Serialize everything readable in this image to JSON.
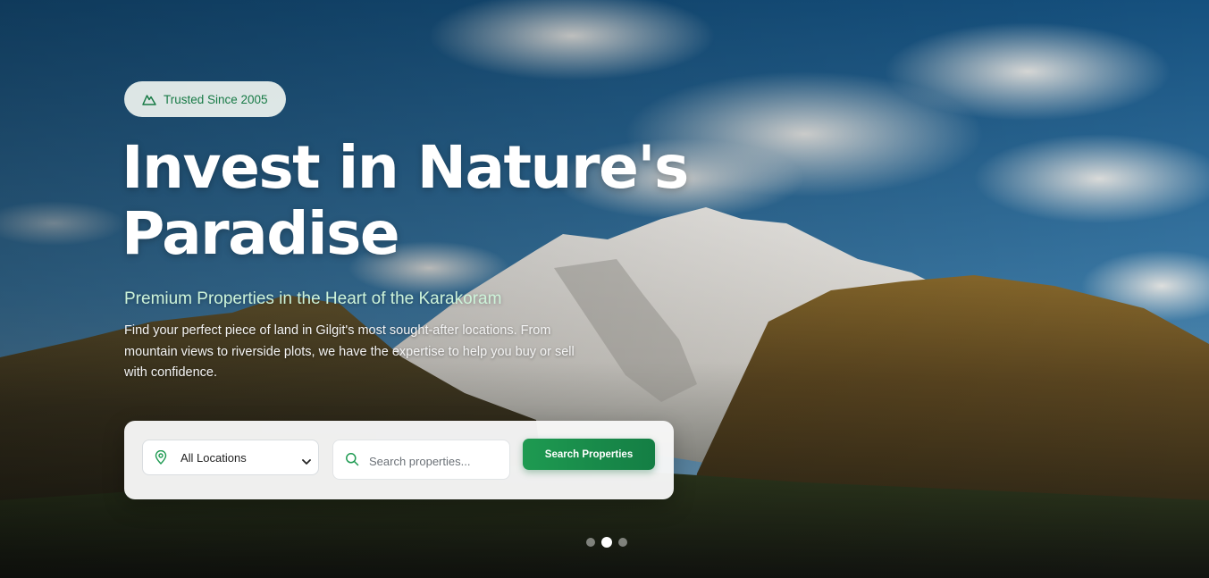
{
  "hero": {
    "badge_text": "Trusted Since 2005",
    "title_line1": "Invest in Nature's",
    "title_line2": "Paradise",
    "subtitle": "Premium Properties in the Heart of the Karakoram",
    "description": "Find your perfect piece of land in Gilgit's most sought-after locations. From mountain views to riverside plots, we have the expertise to help you buy or sell with confidence."
  },
  "search": {
    "location_selected": "All Locations",
    "search_placeholder": "Search properties...",
    "search_value": "",
    "button_label": "Search Properties"
  },
  "carousel": {
    "slide_count": 3,
    "active_index": 1
  },
  "colors": {
    "accent": "#1e9a51",
    "accent_dark": "#147e44",
    "subtitle": "#cdf3d9",
    "badge_text": "#177a45"
  },
  "icons": {
    "badge": "mountain-icon",
    "location": "map-pin-icon",
    "search": "search-icon",
    "dropdown": "chevron-down-icon"
  }
}
